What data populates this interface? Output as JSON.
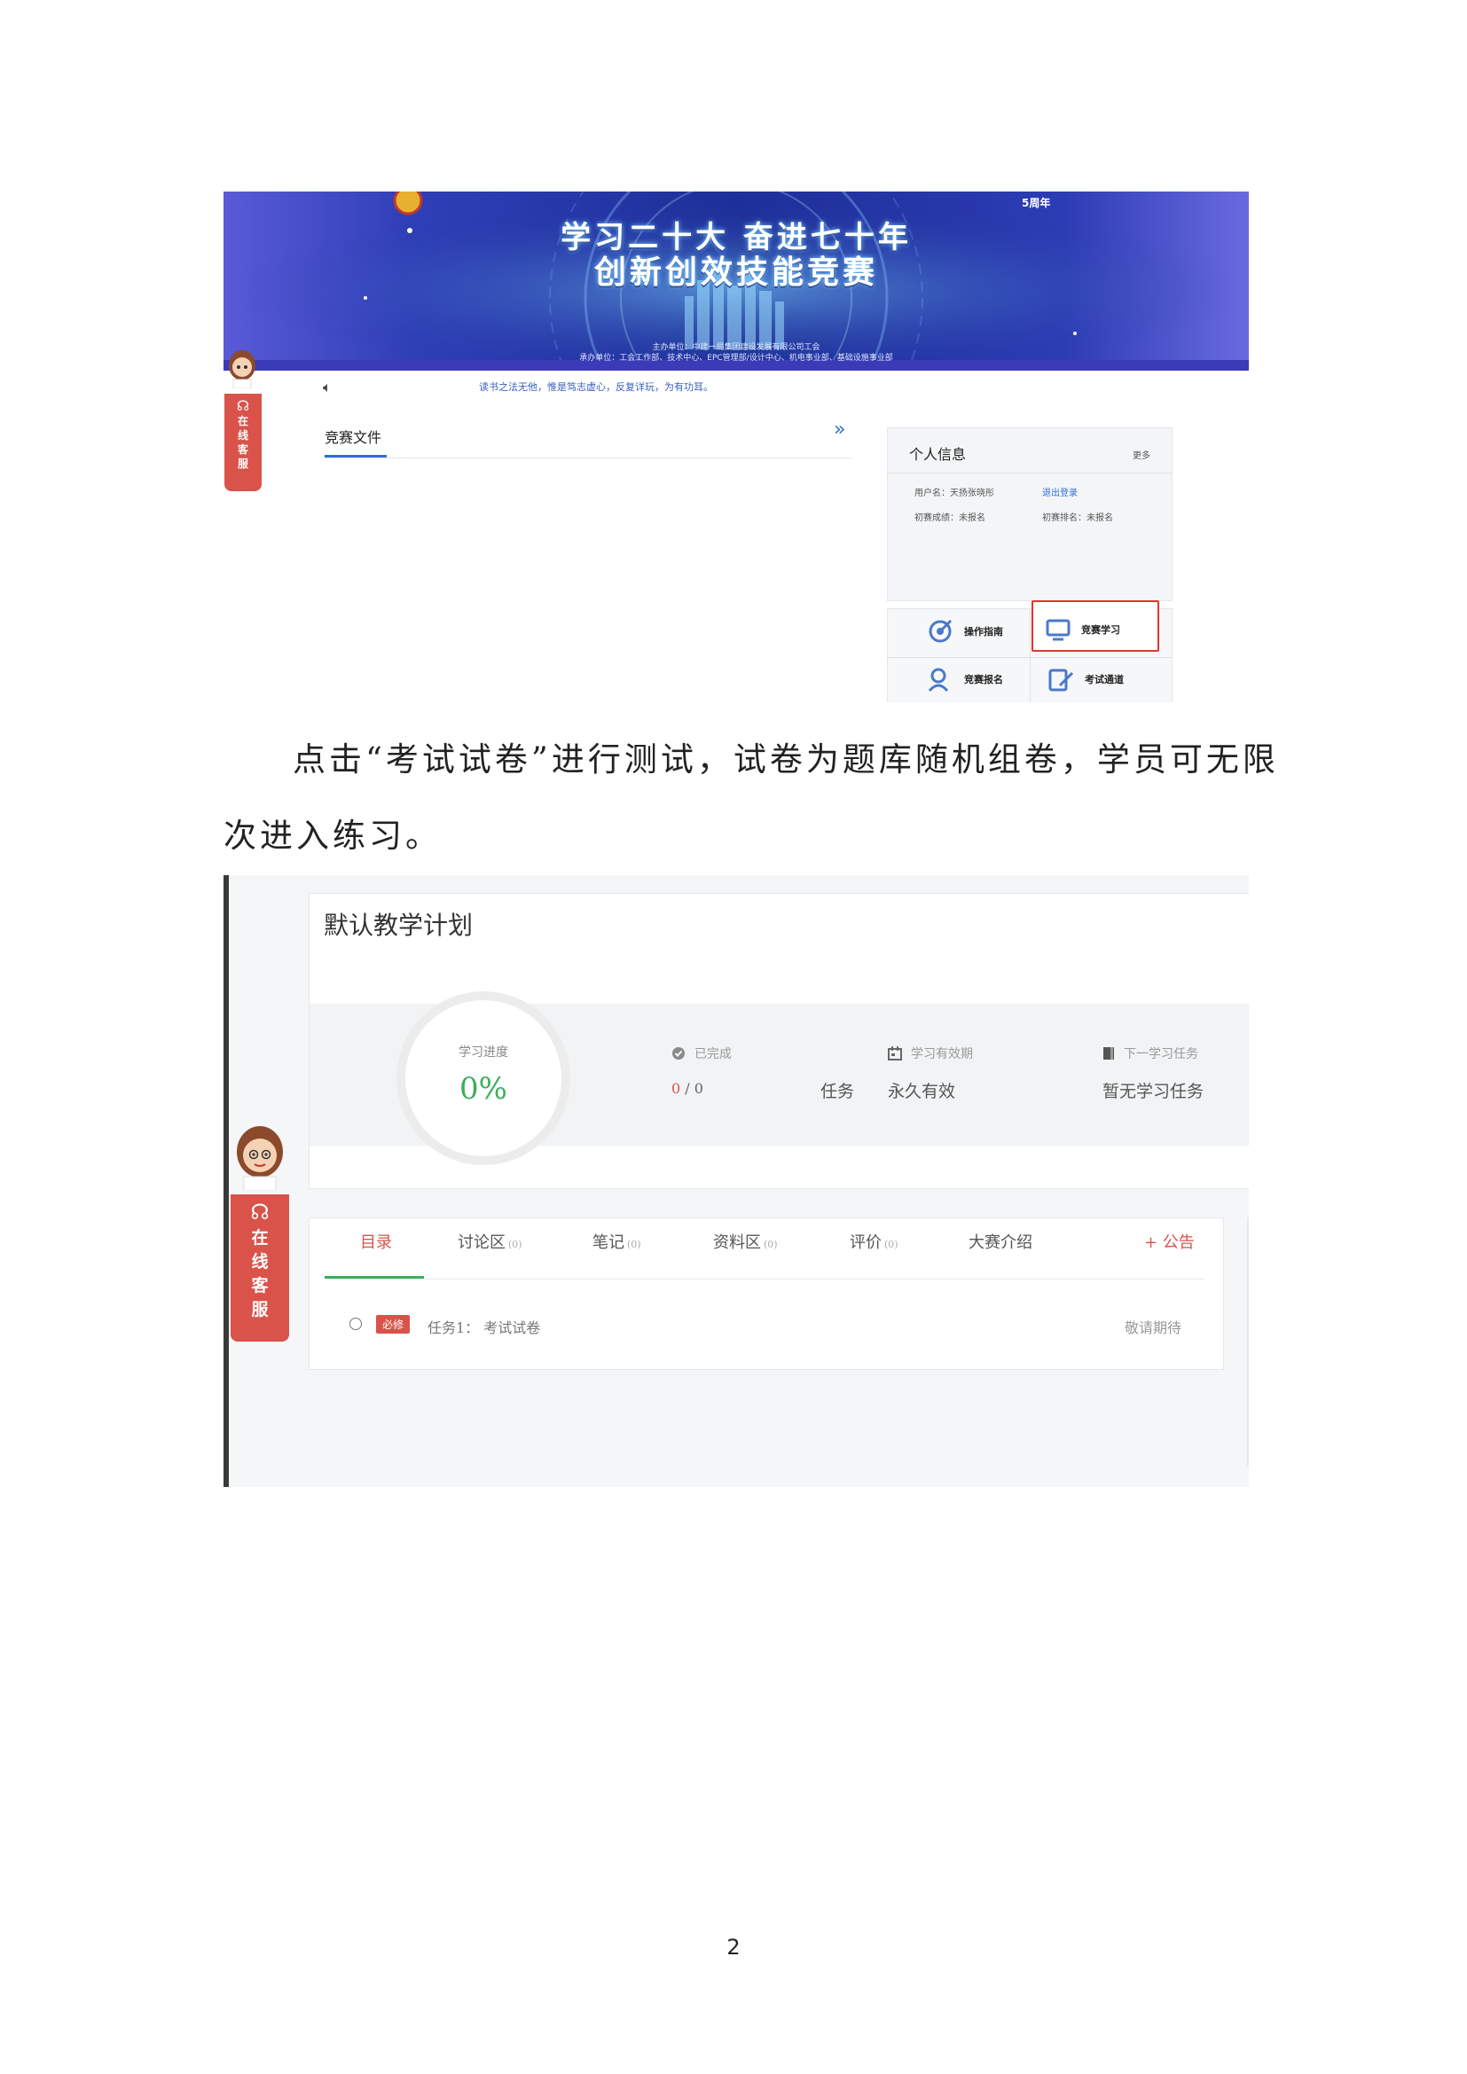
{
  "shot1": {
    "banner": {
      "title_line1": "学习二十大 奋进七十年",
      "title_line2": "创新创效技能竞赛",
      "sub_line1": "主办单位：中建一局集团建设发展有限公司工会",
      "sub_line2": "承办单位：工会工作部、技术中心、EPC管理部/设计中心、机电事业部、基础设施事业部",
      "corner_logo": "5周年"
    },
    "notice": "读书之法无他，惟是笃志虚心，反复详玩，为有功耳。",
    "section_title": "竞赛文件",
    "more_arrow": "»",
    "cs_tab": [
      "在",
      "线",
      "客",
      "服"
    ],
    "personal": {
      "title": "个人信息",
      "more": "更多",
      "username_label": "用户名：天扬张晓彤",
      "logout": "退出登录",
      "score": "初赛成绩：未报名",
      "rank": "初赛排名：未报名"
    },
    "actions": {
      "guide": "操作指南",
      "study": "竞赛学习",
      "signup": "竞赛报名",
      "exam": "考试通道"
    }
  },
  "paragraph": {
    "line1": "点击“考试试卷”进行测试，试卷为题库随机组卷，学员可无限",
    "line2": "次进入练习。"
  },
  "shot2": {
    "plan_title": "默认教学计划",
    "progress_label": "学习进度",
    "progress_value": "0%",
    "stats": {
      "done_label": "已完成",
      "done_value_a": "0",
      "done_value_b": "/ 0",
      "done_unit": "任务",
      "valid_label": "学习有效期",
      "valid_value": "永久有效",
      "next_label": "下一学习任务",
      "next_value": "暂无学习任务"
    },
    "tabs": {
      "catalog": "目录",
      "discuss": "讨论区",
      "discuss_count": "(0)",
      "notes": "笔记",
      "notes_count": "(0)",
      "materials": "资料区",
      "materials_count": "(0)",
      "review": "评价",
      "review_count": "(0)",
      "intro": "大赛介绍",
      "announce": "+ 公告"
    },
    "task": {
      "badge": "必修",
      "label": "任务1：",
      "name": "考试试卷",
      "status": "敬请期待"
    },
    "cs_tab": [
      "在",
      "线",
      "客",
      "服"
    ]
  },
  "page_number": "2"
}
